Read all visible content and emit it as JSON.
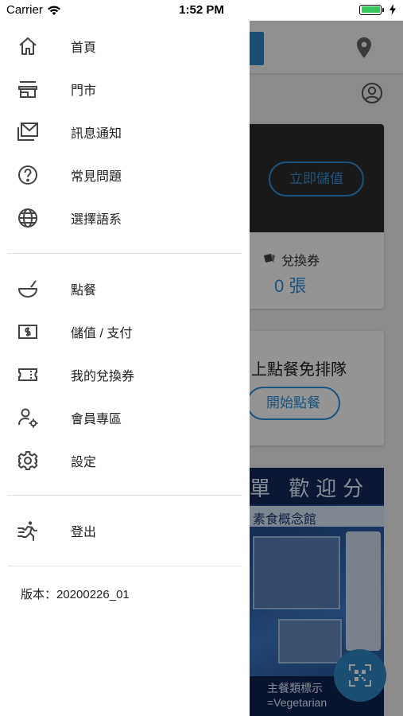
{
  "status_bar": {
    "carrier": "Carrier",
    "time": "1:52 PM",
    "battery_level": 1.0
  },
  "drawer": {
    "group1": [
      {
        "label": "首頁",
        "icon": "home-icon"
      },
      {
        "label": "門市",
        "icon": "store-icon"
      },
      {
        "label": "訊息通知",
        "icon": "mail-icon"
      },
      {
        "label": "常見問題",
        "icon": "help-circle-icon"
      },
      {
        "label": "選擇語系",
        "icon": "globe-icon"
      }
    ],
    "group2": [
      {
        "label": "點餐",
        "icon": "bowl-icon"
      },
      {
        "label": "儲值 / 支付",
        "icon": "dollar-bill-icon"
      },
      {
        "label": "我的兌換券",
        "icon": "ticket-icon"
      },
      {
        "label": "會員專區",
        "icon": "user-settings-icon"
      },
      {
        "label": "設定",
        "icon": "gear-icon"
      }
    ],
    "group3": [
      {
        "label": "登出",
        "icon": "run-exit-icon"
      }
    ],
    "version": "版本：20200226_01"
  },
  "background": {
    "topup_button": "立即儲值",
    "coupon_label": "兌換券",
    "coupon_count": "0 張",
    "promo_text": "上點餐免排隊",
    "order_button": "開始點餐",
    "banner_title": "單 歡迎分",
    "banner_subtitle": "素食概念館",
    "banner_footer": "主餐類標示\n=Vegetarian"
  },
  "colors": {
    "accent": "#2d90d6",
    "fab": "#2d88c7",
    "dark_card": "#2b2b2b"
  }
}
